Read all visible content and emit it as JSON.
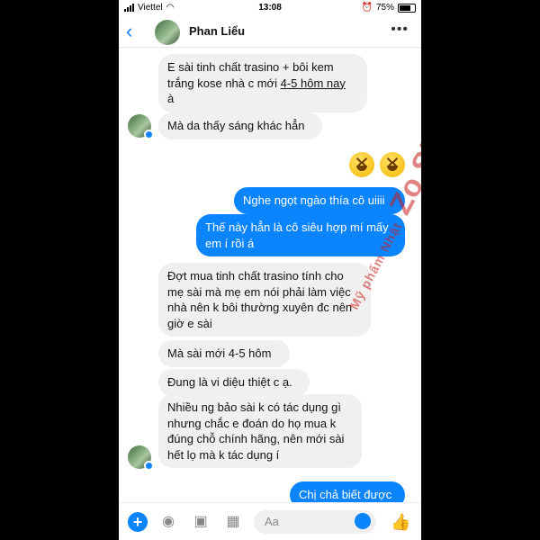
{
  "status": {
    "carrier": "Viettel",
    "time": "13:08",
    "battery": "75%"
  },
  "header": {
    "contact_name": "Phan Liểu"
  },
  "messages": {
    "m1": "E sài tinh chất trasino + bôi kem trắng kose nhà c mới ",
    "m1_u": "4-5 hôm nay",
    "m1_end": "à",
    "m2": "Mà da thấy sáng khác hẳn",
    "m3": "Nghe ngọt ngào thía cô uiiii",
    "m4": "Thế này hẳn là cô siêu hợp mí mấy em í rồi á",
    "m5": "Đợt mua tinh chất trasino tính cho mẹ sài mà mẹ em nói phải làm việc nhà nên k bôi thường xuyên đc nên giờ e sài",
    "m6": "Mà sài mới 4-5 hôm",
    "m7": "Đung là vi diệu thiệt c ạ.",
    "m8": "Nhiều ng bảo sài k có tác dụng gì nhưng chắc e đoán do họ mua k đúng chỗ chính hãng, nên mới sài hết lọ mà k tác dụng í",
    "m9": "Chị chả biết được"
  },
  "watermark": {
    "line1": "Mỹ phẩm Nhật",
    "line2": "Zo Shop"
  },
  "composer": {
    "placeholder": "Aa"
  },
  "icons": [
    "back-icon",
    "more-icon",
    "plus-icon",
    "camera-icon",
    "image-icon",
    "grid-icon",
    "emoji-icon",
    "like-icon"
  ],
  "colors": {
    "accent": "#0a84ff",
    "incoming": "#f0f0f0"
  }
}
